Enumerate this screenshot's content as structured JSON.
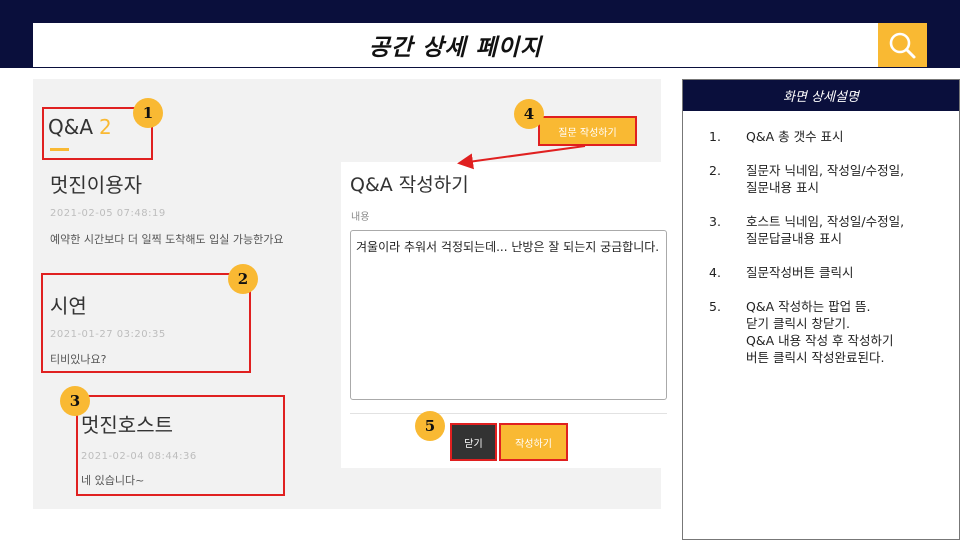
{
  "header": {
    "title": "공간 상세 페이지",
    "search_icon": "search-icon"
  },
  "qa": {
    "title": "Q&A",
    "count": "2",
    "ask_button": "질문 작성하기",
    "entries": [
      {
        "name": "멋진이용자",
        "date": "2021-02-05 07:48:19",
        "text": "예약한 시간보다 더 일찍 도착해도 입실 가능한가요"
      },
      {
        "name": "시연",
        "date": "2021-01-27 03:20:35",
        "text": "티비있나요?"
      },
      {
        "name": "멋진호스트",
        "date": "2021-02-04 08:44:36",
        "text": "네 있습니다~"
      }
    ]
  },
  "popup": {
    "title": "Q&A 작성하기",
    "label": "내용",
    "content": "겨울이라 추워서 걱정되는데... 난방은 잘 되는지 궁금합니다.",
    "close_button": "닫기",
    "submit_button": "작성하기"
  },
  "markers": [
    "1",
    "2",
    "3",
    "4",
    "5"
  ],
  "panel": {
    "title": "화면 상세설명",
    "items": [
      {
        "num": "1.",
        "lines": [
          "Q&A 총 갯수 표시"
        ]
      },
      {
        "num": "2.",
        "lines": [
          "질문자 닉네임, 작성일/수정일,",
          "질문내용 표시"
        ]
      },
      {
        "num": "3.",
        "lines": [
          "호스트 닉네임, 작성일/수정일,",
          "질문답글내용 표시"
        ]
      },
      {
        "num": "4.",
        "lines": [
          "질문작성버튼 클릭시"
        ]
      },
      {
        "num": "5.",
        "lines": [
          "Q&A 작성하는 팝업 뜸.",
          "닫기 클릭시 창닫기.",
          "Q&A 내용 작성 후 작성하기",
          "버튼 클릭시 작성완료된다."
        ]
      }
    ]
  },
  "colors": {
    "navy": "#0a0f3c",
    "accent": "#f9b933",
    "highlight": "#e02020"
  }
}
